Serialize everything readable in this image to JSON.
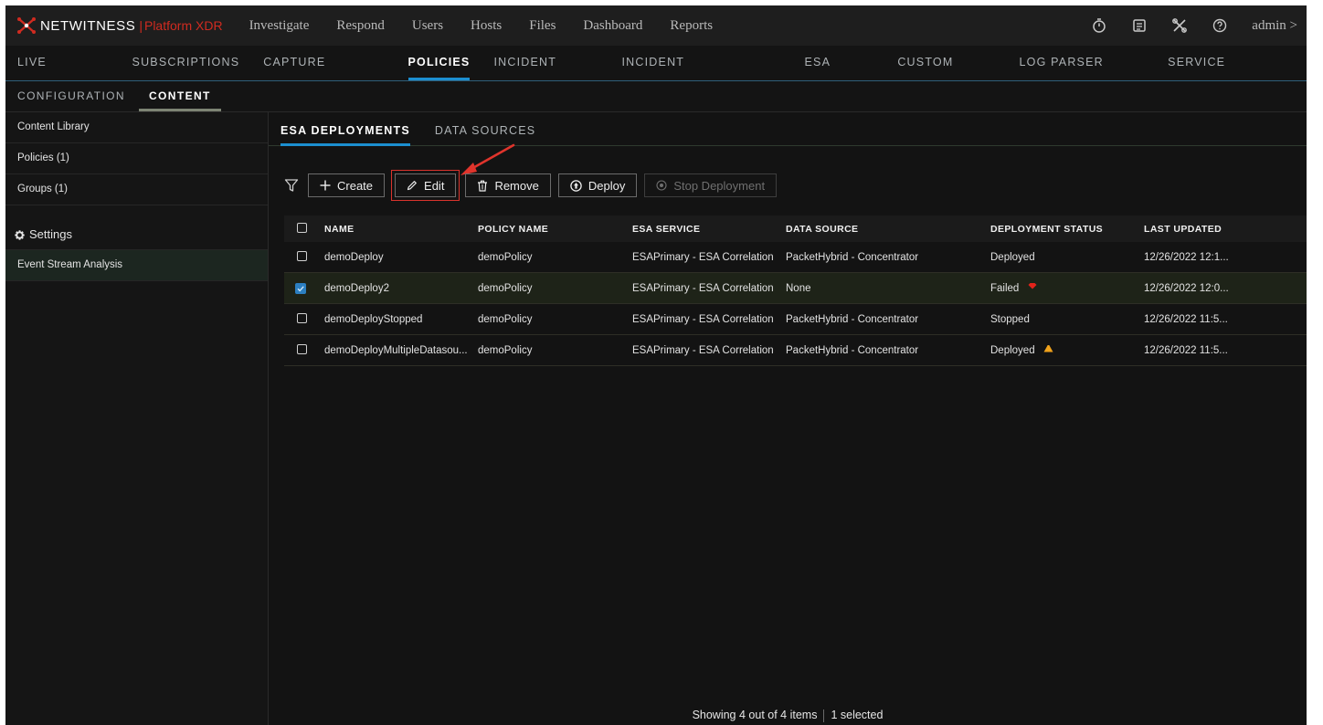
{
  "brand": {
    "name": "NETWITNESS",
    "separator": "|",
    "product": "Platform XDR"
  },
  "main_nav": [
    "Investigate",
    "Respond",
    "Users",
    "Hosts",
    "Files",
    "Dashboard",
    "Reports"
  ],
  "top_icons": [
    "stopwatch-icon",
    "clipboard-icon",
    "tools-icon",
    "help-icon"
  ],
  "user": {
    "label": "admin >"
  },
  "secondary_nav": [
    {
      "label": "LIVE CONTENT",
      "active": false
    },
    {
      "label": "SUBSCRIPTIONS",
      "active": false
    },
    {
      "label": "CAPTURE POLICIES",
      "active": false
    },
    {
      "label": "POLICIES",
      "active": true
    },
    {
      "label": "INCIDENT RULES",
      "active": false
    },
    {
      "label": "INCIDENT NOTIFICATIONS",
      "active": false
    },
    {
      "label": "ESA RULES",
      "active": false
    },
    {
      "label": "CUSTOM FEEDS",
      "active": false
    },
    {
      "label": "LOG PARSER RULES",
      "active": false
    },
    {
      "label": "SERVICE TOPOLOGY",
      "active": false
    }
  ],
  "tertiary_nav": [
    {
      "label": "CONFIGURATION",
      "active": false
    },
    {
      "label": "CONTENT",
      "active": true
    }
  ],
  "sidebar": {
    "items": [
      "Content Library",
      "Policies (1)",
      "Groups (1)"
    ],
    "settings_label": "Settings",
    "settings_items": [
      "Event Stream Analysis"
    ]
  },
  "tabs": [
    {
      "label": "ESA DEPLOYMENTS",
      "active": true
    },
    {
      "label": "DATA SOURCES",
      "active": false
    }
  ],
  "toolbar": {
    "create": "Create",
    "edit": "Edit",
    "remove": "Remove",
    "deploy": "Deploy",
    "stop": "Stop Deployment"
  },
  "table": {
    "columns": [
      "NAME",
      "POLICY NAME",
      "ESA SERVICE",
      "DATA SOURCE",
      "DEPLOYMENT STATUS",
      "LAST UPDATED"
    ],
    "rows": [
      {
        "checked": false,
        "name": "demoDeploy",
        "policy": "demoPolicy",
        "service": "ESAPrimary - ESA Correlation",
        "source": "PacketHybrid - Concentrator",
        "status": "Deployed",
        "status_icon": "",
        "updated": "12/26/2022 12:1..."
      },
      {
        "checked": true,
        "name": "demoDeploy2",
        "policy": "demoPolicy",
        "service": "ESAPrimary - ESA Correlation",
        "source": "None",
        "status": "Failed",
        "status_icon": "error-diamond-icon",
        "updated": "12/26/2022 12:0..."
      },
      {
        "checked": false,
        "name": "demoDeployStopped",
        "policy": "demoPolicy",
        "service": "ESAPrimary - ESA Correlation",
        "source": "PacketHybrid - Concentrator",
        "status": "Stopped",
        "status_icon": "",
        "updated": "12/26/2022 11:5..."
      },
      {
        "checked": false,
        "name": "demoDeployMultipleDatasou...",
        "policy": "demoPolicy",
        "service": "ESAPrimary - ESA Correlation",
        "source": "PacketHybrid - Concentrator",
        "status": "Deployed",
        "status_icon": "warning-triangle-icon",
        "updated": "12/26/2022 11:5..."
      }
    ]
  },
  "footer": {
    "showing": "Showing 4 out of 4 items",
    "selected": "1 selected"
  },
  "colors": {
    "accent": "#1c8fd0",
    "brand_red": "#d02b20",
    "annotation_red": "#d9332c",
    "warning": "#f0a21b"
  }
}
